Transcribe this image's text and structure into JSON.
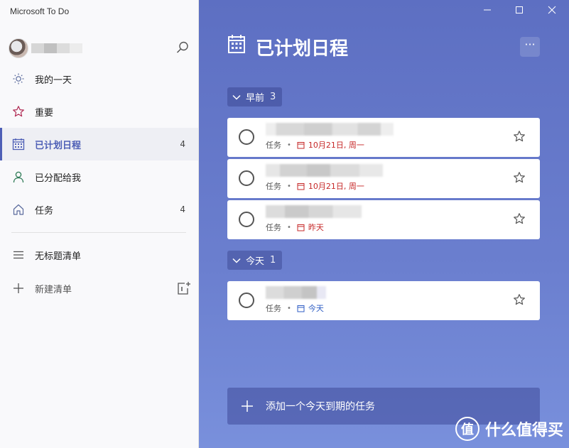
{
  "app": {
    "title": "Microsoft To Do"
  },
  "sidebar": {
    "items": [
      {
        "label": "我的一天",
        "count": ""
      },
      {
        "label": "重要",
        "count": ""
      },
      {
        "label": "已计划日程",
        "count": "4"
      },
      {
        "label": "已分配给我",
        "count": ""
      },
      {
        "label": "任务",
        "count": "4"
      }
    ],
    "lists": [
      {
        "label": "无标题清单"
      }
    ],
    "new_list_label": "新建清单"
  },
  "main": {
    "title": "已计划日程",
    "more_label": "···",
    "groups": [
      {
        "label": "早前",
        "count": "3",
        "tasks": [
          {
            "list": "任务",
            "due": "10月21日, 周一",
            "status": "overdue"
          },
          {
            "list": "任务",
            "due": "10月21日, 周一",
            "status": "overdue"
          },
          {
            "list": "任务",
            "due": "昨天",
            "status": "overdue"
          }
        ]
      },
      {
        "label": "今天",
        "count": "1",
        "tasks": [
          {
            "list": "任务",
            "due": "今天",
            "status": "today"
          }
        ]
      }
    ],
    "add_task_label": "添加一个今天到期的任务"
  },
  "separator_dot": "•",
  "watermark": {
    "text": "什么值得买",
    "logo_glyph": "值"
  },
  "colors": {
    "accent": "#4e5fb6",
    "overdue": "#c62828",
    "today": "#2f5ec4"
  }
}
